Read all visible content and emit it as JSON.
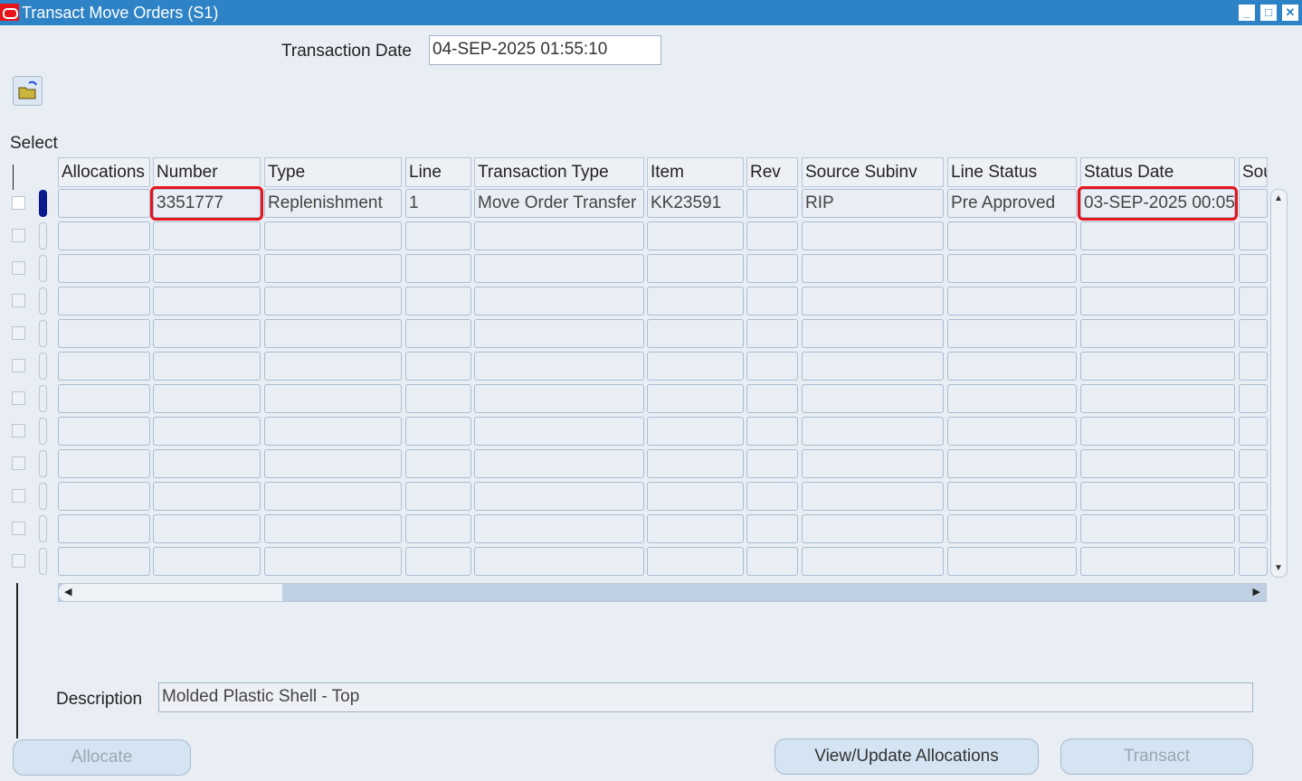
{
  "window": {
    "title": "Transact Move Orders (S1)",
    "minimize": "_",
    "maximize": "□",
    "close": "✕"
  },
  "header": {
    "transaction_date_label": "Transaction Date",
    "transaction_date_value": "04-SEP-2025 01:55:10"
  },
  "grid": {
    "select_label": "Select",
    "columns": [
      "Allocations",
      "Number",
      "Type",
      "Line",
      "Transaction Type",
      "Item",
      "Rev",
      "Source Subinv",
      "Line Status",
      "Status Date",
      "Source Locator"
    ],
    "rows": [
      [
        "",
        "3351777",
        "Replenishment",
        "1",
        "Move Order Transfer",
        "KK23591",
        "",
        "RIP",
        "Pre Approved",
        "03-SEP-2025 00:05",
        ""
      ]
    ]
  },
  "description": {
    "label": "Description",
    "value": "Molded Plastic Shell - Top"
  },
  "buttons": {
    "allocate": "Allocate",
    "view_update": "View/Update Allocations",
    "transact": "Transact"
  }
}
